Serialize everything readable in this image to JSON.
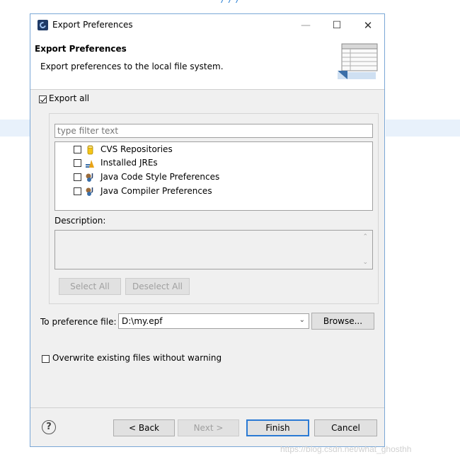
{
  "background": {
    "partial_title": "/ / /",
    "watermark": "https://blog.csdn.net/what_ghosthh"
  },
  "window": {
    "title": "Export Preferences",
    "controls": {
      "minimize": "—",
      "maximize": "☐",
      "close": "✕"
    }
  },
  "header": {
    "title": "Export Preferences",
    "description": "Export preferences to the local file system."
  },
  "export_all": {
    "label": "Export all",
    "checked": true
  },
  "filter": {
    "placeholder": "type filter text",
    "value": ""
  },
  "tree_items": [
    {
      "label": "CVS Repositories",
      "checked": false,
      "icon": "cylinder-icon"
    },
    {
      "label": "Installed JREs",
      "checked": false,
      "icon": "jre-icon"
    },
    {
      "label": "Java Code Style Preferences",
      "checked": false,
      "icon": "java-gears-icon"
    },
    {
      "label": "Java Compiler Preferences",
      "checked": false,
      "icon": "java-gears-icon"
    }
  ],
  "description": {
    "label": "Description:",
    "value": ""
  },
  "buttons": {
    "select_all": "Select All",
    "deselect_all": "Deselect All",
    "browse": "Browse...",
    "back": "< Back",
    "next": "Next >",
    "finish": "Finish",
    "cancel": "Cancel"
  },
  "preference_file": {
    "label": "To preference file:",
    "value": "D:\\my.epf"
  },
  "overwrite": {
    "label": "Overwrite existing files without warning",
    "checked": false
  },
  "help": "?",
  "colors": {
    "accent": "#2b7ad4",
    "dialog_bg": "#f0f0f0",
    "border": "#7aa7d6"
  }
}
